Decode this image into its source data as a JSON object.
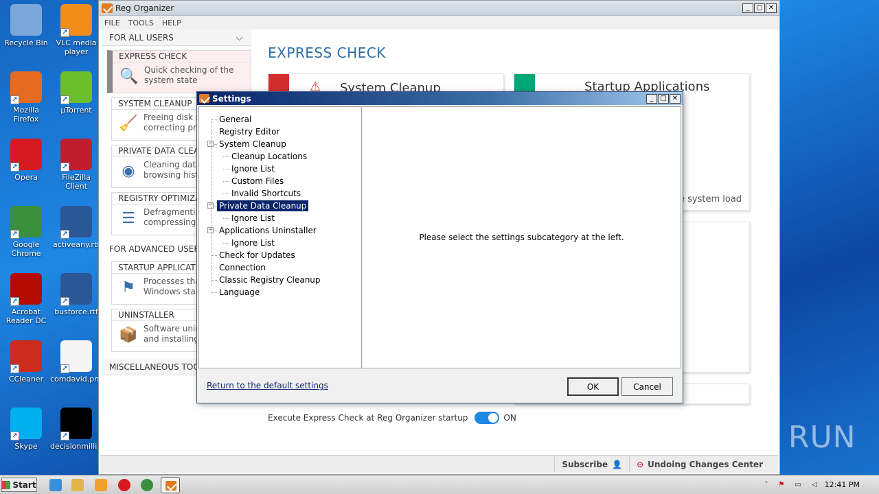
{
  "desktop": {
    "icons": [
      {
        "label": "Recycle Bin",
        "icon": "recycle-bin-icon",
        "color": "#7aa7d8"
      },
      {
        "label": "VLC media player",
        "icon": "vlc-icon",
        "color": "#f28c1a"
      },
      {
        "label": "Mozilla Firefox",
        "icon": "firefox-icon",
        "color": "#e66a1f"
      },
      {
        "label": "µTorrent",
        "icon": "utorrent-icon",
        "color": "#6cbf2a"
      },
      {
        "label": "Opera",
        "icon": "opera-icon",
        "color": "#d71a21"
      },
      {
        "label": "FileZilla Client",
        "icon": "filezilla-icon",
        "color": "#bf1e2e"
      },
      {
        "label": "Google Chrome",
        "icon": "chrome-icon",
        "color": "#3c8f3c"
      },
      {
        "label": "activeany.rtf",
        "icon": "word-doc-icon",
        "color": "#2b5797"
      },
      {
        "label": "Acrobat Reader DC",
        "icon": "acrobat-icon",
        "color": "#b30b00"
      },
      {
        "label": "busforce.rtf",
        "icon": "word-doc-icon",
        "color": "#2b5797"
      },
      {
        "label": "CCleaner",
        "icon": "ccleaner-icon",
        "color": "#cc2b1e"
      },
      {
        "label": "comdavid.png",
        "icon": "image-file-icon",
        "color": "#f5f5f5"
      },
      {
        "label": "Skype",
        "icon": "skype-icon",
        "color": "#00aff0"
      },
      {
        "label": "decisionmilli...",
        "icon": "black-file-icon",
        "color": "#000000"
      }
    ],
    "watermark": "ANY RUN"
  },
  "app": {
    "title": "Reg Organizer",
    "menu": [
      "FILE",
      "TOOLS",
      "HELP"
    ],
    "sidebar": {
      "section_users": "FOR ALL USERS",
      "section_advanced": "FOR ADVANCED USERS",
      "section_misc": "MISCELLANEOUS TOOLS",
      "categories": [
        {
          "title": "EXPRESS CHECK",
          "desc1": "Quick checking of the",
          "desc2": "system state",
          "icon": "magnifier-check-icon"
        },
        {
          "title": "SYSTEM CLEANUP",
          "desc1": "Freeing disk s",
          "desc2": "correcting pro",
          "icon": "cleanup-broom-icon"
        },
        {
          "title": "PRIVATE DATA CLEA",
          "desc1": "Cleaning data",
          "desc2": "browsing hist",
          "icon": "private-data-icon"
        },
        {
          "title": "REGISTRY OPTIMIZA",
          "desc1": "Defragmentin",
          "desc2": "compressing",
          "icon": "registry-defrag-icon"
        }
      ],
      "advanced_categories": [
        {
          "title": "STARTUP APPLICATIO",
          "desc1": "Processes tha",
          "desc2": "Windows star",
          "icon": "startup-flag-icon"
        },
        {
          "title": "UNINSTALLER",
          "desc1": "Software unin",
          "desc2": "and installing",
          "icon": "uninstaller-box-icon"
        }
      ]
    },
    "main": {
      "title": "EXPRESS CHECK",
      "tile1_title": "System Cleanup",
      "tile2_title": "Startup Applications",
      "tile2_sub": "e system load",
      "tile1_color": "#d32f2f",
      "tile2_color": "#00a878",
      "startup_label": "Execute Express Check at Reg Organizer startup",
      "toggle_state": "ON"
    },
    "statusbar": {
      "subscribe": "Subscribe",
      "undo_center": "Undoing Changes Center"
    }
  },
  "dialog": {
    "title": "Settings",
    "tree": [
      {
        "label": "General",
        "level": 0
      },
      {
        "label": "Registry Editor",
        "level": 0
      },
      {
        "label": "System Cleanup",
        "level": 0,
        "expandable": true
      },
      {
        "label": "Cleanup Locations",
        "level": 1
      },
      {
        "label": "Ignore List",
        "level": 1
      },
      {
        "label": "Custom Files",
        "level": 1
      },
      {
        "label": "Invalid Shortcuts",
        "level": 1
      },
      {
        "label": "Private Data Cleanup",
        "level": 0,
        "expandable": true,
        "selected": true
      },
      {
        "label": "Ignore List",
        "level": 1
      },
      {
        "label": "Applications Uninstaller",
        "level": 0,
        "expandable": true
      },
      {
        "label": "Ignore List",
        "level": 1
      },
      {
        "label": "Check for Updates",
        "level": 0
      },
      {
        "label": "Connection",
        "level": 0
      },
      {
        "label": "Classic Registry Cleanup",
        "level": 0
      },
      {
        "label": "Language",
        "level": 0
      }
    ],
    "info_text": "Please select the settings subcategory at the left.",
    "reset_link": "Return to the default settings",
    "ok_label": "OK",
    "cancel_label": "Cancel"
  },
  "taskbar": {
    "start_label": "Start",
    "clock": "12:41 PM"
  }
}
